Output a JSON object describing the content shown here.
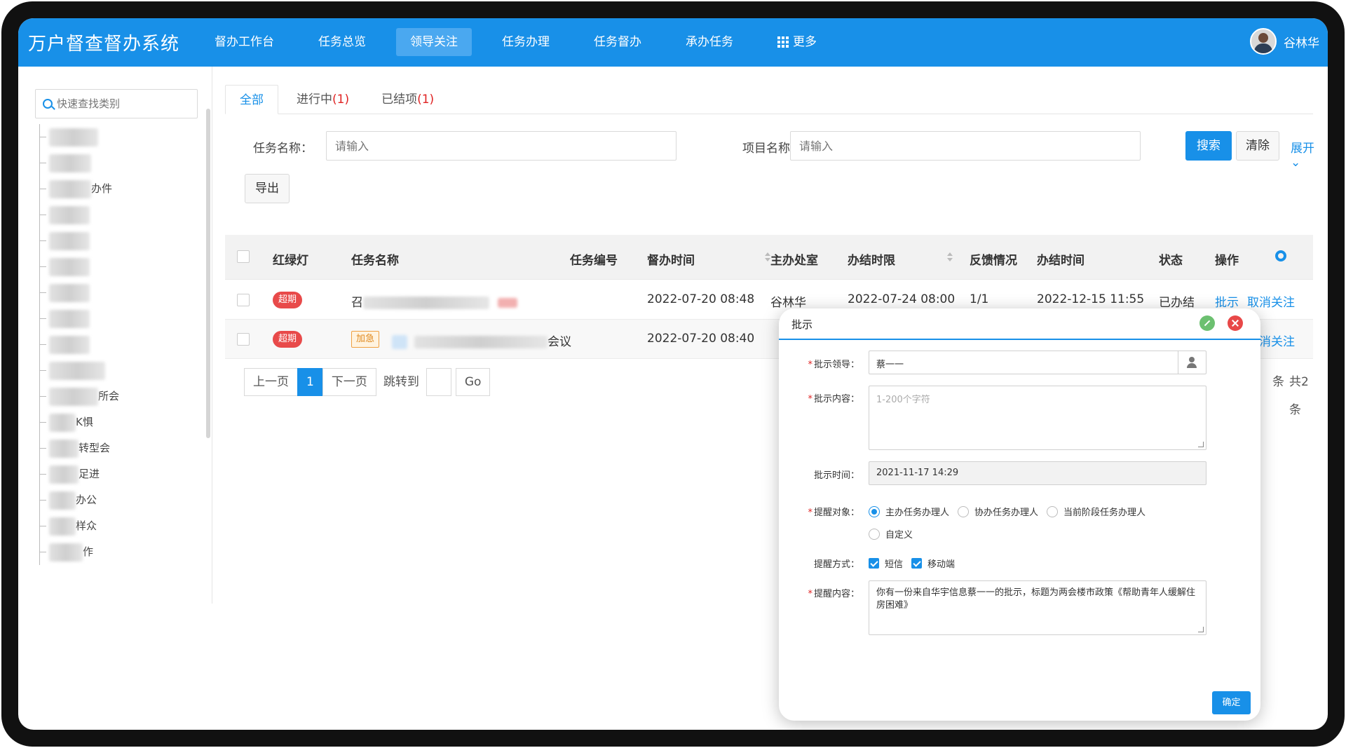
{
  "app": {
    "title": "万户督查督办系统"
  },
  "nav": {
    "items": [
      {
        "label": "督办工作台"
      },
      {
        "label": "任务总览"
      },
      {
        "label": "领导关注"
      },
      {
        "label": "任务办理"
      },
      {
        "label": "任务督办"
      },
      {
        "label": "承办任务"
      },
      {
        "label": "更多"
      }
    ],
    "active_index": 2
  },
  "user": {
    "name": "谷林华"
  },
  "sidebar": {
    "search_placeholder": "快速查找类别",
    "items": [
      {
        "visible_text": ""
      },
      {
        "visible_text": ""
      },
      {
        "visible_text": "办件"
      },
      {
        "visible_text": ""
      },
      {
        "visible_text": ""
      },
      {
        "visible_text": ""
      },
      {
        "visible_text": ""
      },
      {
        "visible_text": ""
      },
      {
        "visible_text": ""
      },
      {
        "visible_text": ""
      },
      {
        "visible_text": "所会"
      },
      {
        "visible_text": "K惧"
      },
      {
        "visible_text": "转型会"
      },
      {
        "visible_text": "足进"
      },
      {
        "visible_text": "办公"
      },
      {
        "visible_text": "样众"
      },
      {
        "visible_text": "作"
      }
    ]
  },
  "tabs": [
    {
      "label": "全部",
      "count": ""
    },
    {
      "label": "进行中",
      "count": "(1)"
    },
    {
      "label": "已结项",
      "count": "(1)"
    }
  ],
  "filters": {
    "task_name_label": "任务名称：",
    "task_name_placeholder": "请输入",
    "project_name_label": "项目名称：",
    "project_name_placeholder": "请输入",
    "search_label": "搜索",
    "clear_label": "清除",
    "expand_label": "展开"
  },
  "toolbar": {
    "export_label": "导出"
  },
  "table": {
    "columns": [
      "红绿灯",
      "任务名称",
      "任务编号",
      "督办时间",
      "主办处室",
      "办结时限",
      "反馈情况",
      "办结时间",
      "状态",
      "操作"
    ],
    "rows": [
      {
        "light": "超期",
        "urgent": "",
        "name_visible": "召",
        "code": "",
        "supervise_time": "2022-07-20 08:48",
        "dept": "谷林华",
        "deadline": "2022-07-24 08:00",
        "feedback": "1/1",
        "finish_time": "2022-12-15 11:55",
        "status": "已办结",
        "actions": [
          "批示",
          "取消关注"
        ]
      },
      {
        "light": "超期",
        "urgent": "加急",
        "name_visible": "会议",
        "code": "",
        "supervise_time": "2022-07-20 08:40",
        "dept": "",
        "deadline": "",
        "feedback": "",
        "finish_time": "",
        "status": "",
        "actions": [
          "取消关注"
        ]
      }
    ]
  },
  "pagination": {
    "prev": "上一页",
    "current": "1",
    "next": "下一页",
    "jump_label": "跳转到",
    "go": "Go",
    "per_page_suffix": "条",
    "total": "共2条"
  },
  "modal": {
    "title": "批示",
    "leader_label": "批示领导：",
    "leader_value": "蔡一一",
    "content_label": "批示内容：",
    "content_placeholder": "1-200个字符",
    "time_label": "批示时间：",
    "time_value": "2021-11-17 14:29",
    "target_label": "提醒对象：",
    "target_options": [
      "主办任务办理人",
      "协办任务办理人",
      "当前阶段任务办理人",
      "自定义"
    ],
    "method_label": "提醒方式：",
    "method_options": [
      "短信",
      "移动端"
    ],
    "remind_label": "提醒内容：",
    "remind_value": "你有一份来自华宇信息蔡一一的批示，标题为两会楼市政策《帮助青年人缓解住房困难》",
    "confirm_label": "确定"
  },
  "colors": {
    "primary": "#1890e8",
    "danger": "#e84a4a",
    "warning": "#e08a20"
  }
}
